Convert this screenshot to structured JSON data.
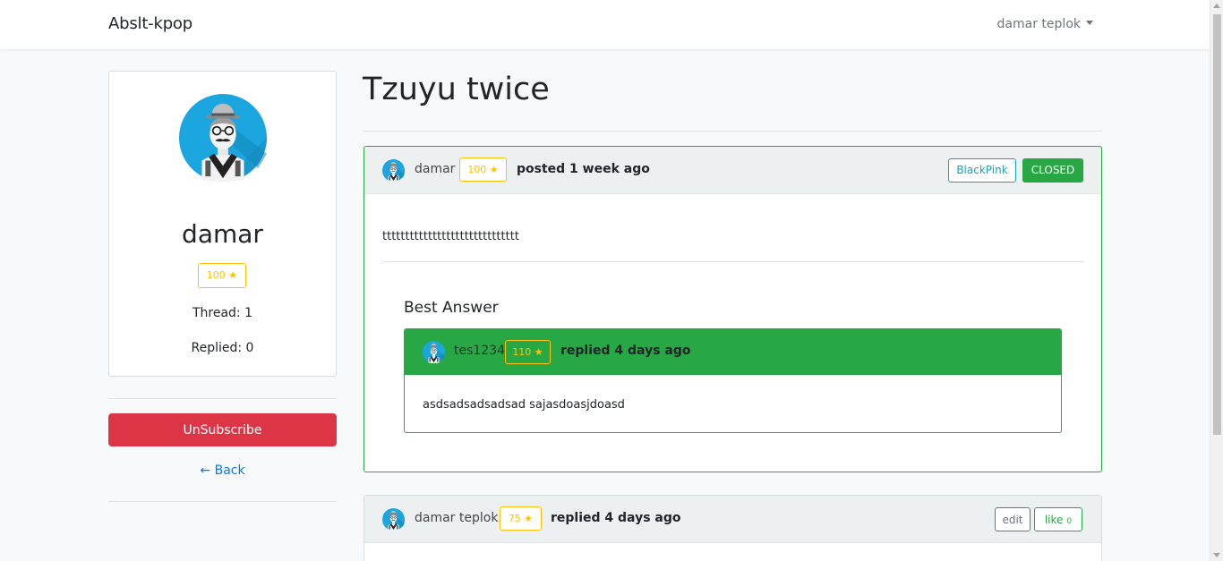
{
  "nav": {
    "brand": "Abslt-kpop",
    "user": "damar teplok"
  },
  "profile": {
    "avatar": "hipster-avatar",
    "name": "damar",
    "stars": "100 ★",
    "thread": "Thread: 1",
    "replied": "Replied: 0"
  },
  "actions": {
    "unsubscribe": "UnSubscribe",
    "back": "← Back"
  },
  "thread": {
    "title": "Tzuyu twice",
    "post": {
      "author": "damar",
      "stars": "100 ★",
      "posted": "posted 1 week ago",
      "tag": "BlackPink",
      "status": "CLOSED",
      "body": "tttttttttttttttttttttttttttttt"
    },
    "best_answer": {
      "title": "Best Answer",
      "author": "tes1234",
      "stars": "110 ★",
      "replied": "replied 4 days ago",
      "body": "asdsadsadsadsad sajasdoasjdoasd"
    },
    "reply": {
      "author": "damar teplok",
      "stars": "75 ★",
      "replied": "replied 4 days ago",
      "edit": "edit",
      "like": "like",
      "like_count": "0"
    }
  },
  "colors": {
    "success": "#28a745",
    "danger": "#dc3545",
    "warning": "#ffc107",
    "info": "#17a2b8",
    "link": "#007bff",
    "avatar_bg": "#1ba1e2"
  }
}
